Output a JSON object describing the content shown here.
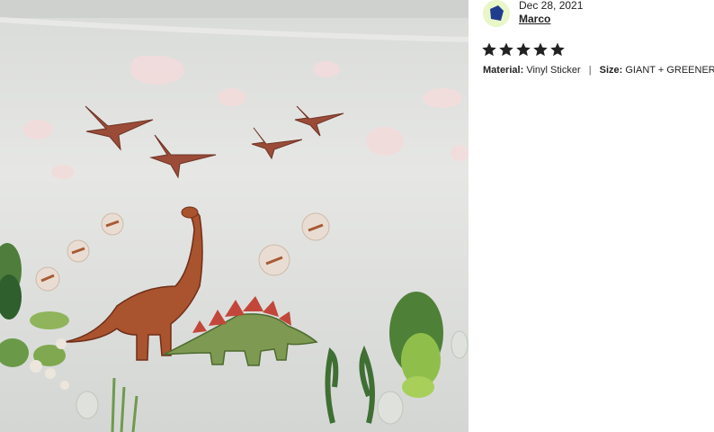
{
  "review": {
    "date": "Dec 28, 2021",
    "author": "Marco",
    "rating": 5,
    "rating_max": 5,
    "variations": [
      {
        "label": "Material:",
        "value": "Vinyl Sticker"
      },
      {
        "label": "Size:",
        "value": "GIANT + GREENERY"
      }
    ],
    "separator": "|"
  },
  "photo": {
    "alt_subject": "dinosaur-wall-decal-photo"
  },
  "colors": {
    "avatar_bg": "#e9f6c8",
    "avatar_shape": "#1f3c8f",
    "star": "#222222",
    "text": "#222222"
  }
}
